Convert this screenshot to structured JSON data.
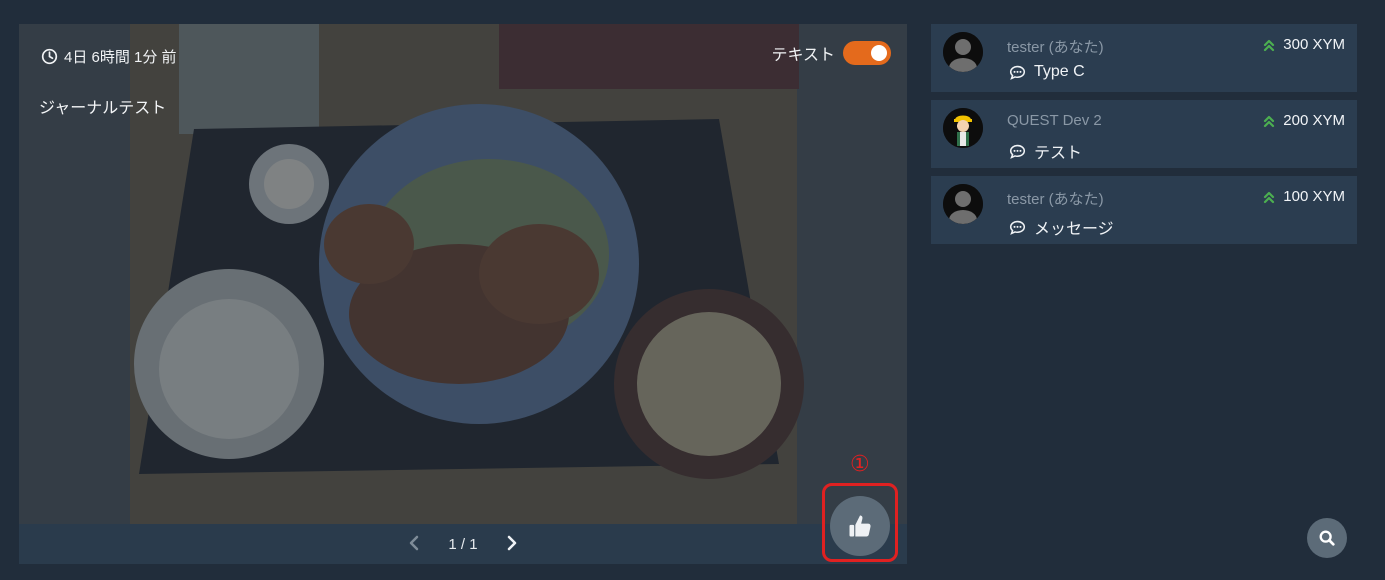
{
  "journal": {
    "time_ago": "4日 6時間 1分 前",
    "text_toggle_label": "テキスト",
    "text_toggle_on": true,
    "body_text": "ジャーナルテスト",
    "pager": {
      "current": "1 / 1"
    },
    "step_marker": "①"
  },
  "comments": [
    {
      "name": "tester (あなた)",
      "amount": "300 XYM",
      "message": "Type C",
      "avatar": "default-avatar"
    },
    {
      "name": "QUEST Dev 2",
      "amount": "200 XYM",
      "message": "テスト",
      "avatar": "worker-avatar"
    },
    {
      "name": "tester (あなた)",
      "amount": "100 XYM",
      "message": "メッセージ",
      "avatar": "default-avatar"
    }
  ],
  "colors": {
    "background": "#212d3b",
    "card": "#2b3d50",
    "accent_orange": "#e46a1c",
    "amount_icon_green": "#4caf50",
    "highlight_red": "#e02121"
  }
}
